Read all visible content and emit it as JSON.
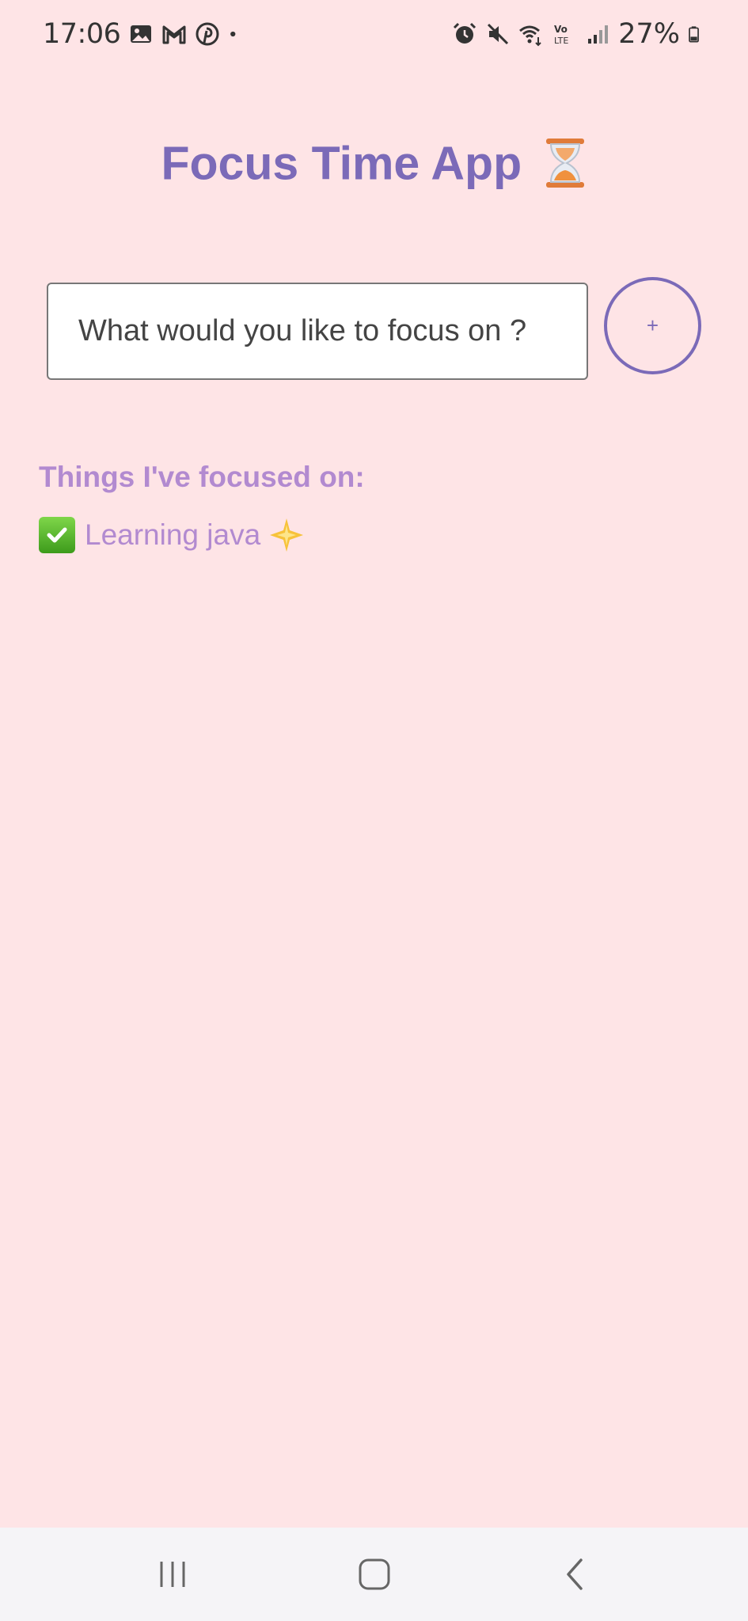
{
  "status_bar": {
    "time": "17:06",
    "battery": "27%",
    "left_icons": [
      "gallery-icon",
      "gmail-icon",
      "pinterest-icon",
      "dot-icon"
    ],
    "right_icons": [
      "alarm-icon",
      "mute-icon",
      "wifi-icon",
      "volte-icon",
      "signal-icon",
      "battery-icon"
    ]
  },
  "header": {
    "title": "Focus Time App",
    "title_emoji": "hourglass-icon"
  },
  "focus_form": {
    "placeholder": "What would you like to focus on ?",
    "value": "",
    "add_label": "+"
  },
  "history": {
    "heading": "Things I've focused on:",
    "items": [
      {
        "label": "Learning java",
        "status_icon": "check-icon",
        "trail_icon": "sparkle-icon"
      }
    ]
  },
  "nav_bar": {
    "buttons": [
      "recents-icon",
      "home-icon",
      "back-icon"
    ]
  },
  "colors": {
    "background": "#fee4e6",
    "title": "#7b6ab8",
    "history_text": "#b28ad0",
    "nav_bg": "#f5f4f7"
  }
}
